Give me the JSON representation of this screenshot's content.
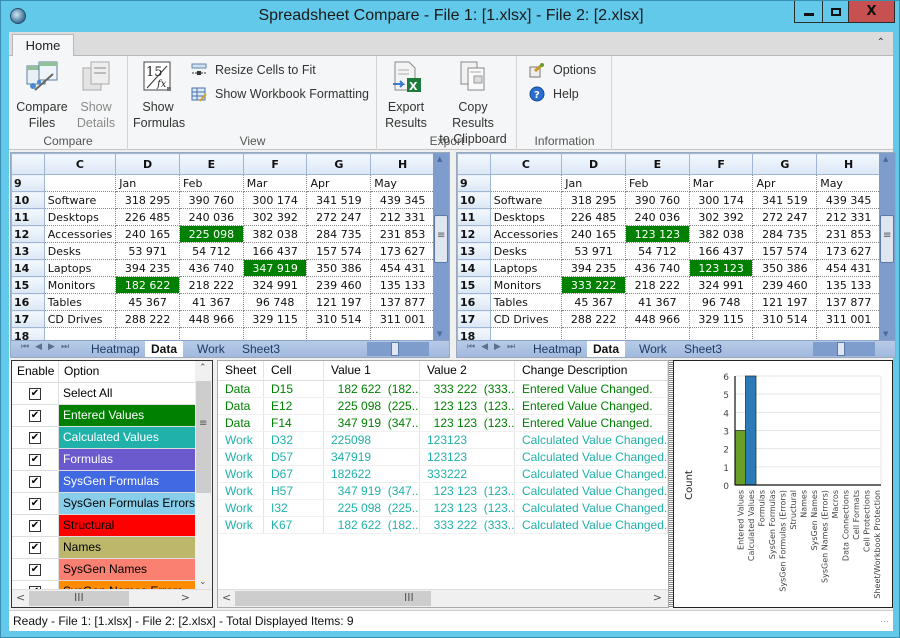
{
  "window": {
    "title": "Spreadsheet Compare - File 1: [1.xlsx] - File 2: [2.xlsx]",
    "close_label": "X"
  },
  "ribbon": {
    "tab": "Home",
    "groups": {
      "compare": {
        "label": "Compare",
        "compare_files": [
          "Compare",
          "Files"
        ],
        "show_details": [
          "Show",
          "Details"
        ]
      },
      "view": {
        "label": "View",
        "show_formulas": [
          "Show",
          "Formulas"
        ],
        "resize_cells": "Resize Cells to Fit",
        "show_workbook_formatting": "Show Workbook Formatting"
      },
      "export": {
        "label": "Export",
        "export_results": [
          "Export",
          "Results"
        ],
        "copy_results": [
          "Copy Results",
          "to Clipboard"
        ]
      },
      "information": {
        "label": "Information",
        "options": "Options",
        "help": "Help"
      }
    }
  },
  "sheets": {
    "columns": [
      "C",
      "D",
      "E",
      "F",
      "G",
      "H"
    ],
    "sheet_tabs": [
      "Heatmap",
      "Data",
      "Work",
      "Sheet3"
    ],
    "active_tab": "Data",
    "left": {
      "rows": [
        {
          "n": "9",
          "cells": [
            "",
            "Jan",
            "Feb",
            "Mar",
            "Apr",
            "May"
          ]
        },
        {
          "n": "10",
          "cells": [
            "Software",
            "318 295",
            "390 760",
            "300 174",
            "341 519",
            "439 345"
          ]
        },
        {
          "n": "11",
          "cells": [
            "Desktops",
            "226 485",
            "240 036",
            "302 392",
            "272 247",
            "212 331"
          ]
        },
        {
          "n": "12",
          "cells": [
            "Accessories",
            "240 165",
            "225 098",
            "382 038",
            "284 735",
            "231 853"
          ],
          "hl": [
            2
          ]
        },
        {
          "n": "13",
          "cells": [
            "Desks",
            "53 971",
            "54 712",
            "166 437",
            "157 574",
            "173 627"
          ]
        },
        {
          "n": "14",
          "cells": [
            "Laptops",
            "394 235",
            "436 740",
            "347 919",
            "350 386",
            "454 431"
          ],
          "hl": [
            3
          ]
        },
        {
          "n": "15",
          "cells": [
            "Monitors",
            "182 622",
            "218 222",
            "324 991",
            "239 460",
            "135 133"
          ],
          "hl": [
            1
          ]
        },
        {
          "n": "16",
          "cells": [
            "Tables",
            "45 367",
            "41 367",
            "96 748",
            "121 197",
            "137 877"
          ]
        },
        {
          "n": "17",
          "cells": [
            "CD Drives",
            "288 222",
            "448 966",
            "329 115",
            "310 514",
            "311 001"
          ]
        },
        {
          "n": "18",
          "cells": [
            "",
            "",
            "",
            "",
            "",
            ""
          ]
        }
      ]
    },
    "right": {
      "rows": [
        {
          "n": "9",
          "cells": [
            "",
            "Jan",
            "Feb",
            "Mar",
            "Apr",
            "May"
          ]
        },
        {
          "n": "10",
          "cells": [
            "Software",
            "318 295",
            "390 760",
            "300 174",
            "341 519",
            "439 345"
          ]
        },
        {
          "n": "11",
          "cells": [
            "Desktops",
            "226 485",
            "240 036",
            "302 392",
            "272 247",
            "212 331"
          ]
        },
        {
          "n": "12",
          "cells": [
            "Accessories",
            "240 165",
            "123 123",
            "382 038",
            "284 735",
            "231 853"
          ],
          "hl": [
            2
          ]
        },
        {
          "n": "13",
          "cells": [
            "Desks",
            "53 971",
            "54 712",
            "166 437",
            "157 574",
            "173 627"
          ]
        },
        {
          "n": "14",
          "cells": [
            "Laptops",
            "394 235",
            "436 740",
            "123 123",
            "350 386",
            "454 431"
          ],
          "hl": [
            3
          ]
        },
        {
          "n": "15",
          "cells": [
            "Monitors",
            "333 222",
            "218 222",
            "324 991",
            "239 460",
            "135 133"
          ],
          "hl": [
            1
          ]
        },
        {
          "n": "16",
          "cells": [
            "Tables",
            "45 367",
            "41 367",
            "96 748",
            "121 197",
            "137 877"
          ]
        },
        {
          "n": "17",
          "cells": [
            "CD Drives",
            "288 222",
            "448 966",
            "329 115",
            "310 514",
            "311 001"
          ]
        },
        {
          "n": "18",
          "cells": [
            "",
            "",
            "",
            "",
            "",
            ""
          ]
        }
      ]
    },
    "highlight_color": "#008000"
  },
  "options": {
    "headers": [
      "Enable",
      "Option"
    ],
    "items": [
      {
        "label": "Select All",
        "checked": true,
        "bg": "#ffffff",
        "fg": "#000000"
      },
      {
        "label": "Entered Values",
        "checked": true,
        "bg": "#008000",
        "fg": "#ffffff"
      },
      {
        "label": "Calculated Values",
        "checked": true,
        "bg": "#20b2aa",
        "fg": "#ffffff"
      },
      {
        "label": "Formulas",
        "checked": true,
        "bg": "#6a5acd",
        "fg": "#ffffff"
      },
      {
        "label": "SysGen Formulas",
        "checked": true,
        "bg": "#4169e1",
        "fg": "#ffffff"
      },
      {
        "label": "SysGen Formulas Errors",
        "checked": true,
        "bg": "#87ceeb",
        "fg": "#000000"
      },
      {
        "label": "Structural",
        "checked": true,
        "bg": "#ff0000",
        "fg": "#000000"
      },
      {
        "label": "Names",
        "checked": true,
        "bg": "#bdb76b",
        "fg": "#000000"
      },
      {
        "label": "SysGen Names",
        "checked": true,
        "bg": "#fa8072",
        "fg": "#000000"
      },
      {
        "label": "SysGen Names Errors",
        "checked": true,
        "bg": "#ff8c00",
        "fg": "#000000"
      }
    ]
  },
  "results": {
    "headers": [
      "Sheet",
      "Cell",
      "Value 1",
      "Value 2",
      "Change Description"
    ],
    "rows": [
      {
        "sheet": "Data",
        "cell": "D15",
        "v1": "  182 622  (182...",
        "v2": "  333 222  (333...",
        "desc": "Entered Value Changed.",
        "color": "#008000"
      },
      {
        "sheet": "Data",
        "cell": "E12",
        "v1": "  225 098  (225...",
        "v2": "  123 123  (123...",
        "desc": "Entered Value Changed.",
        "color": "#008000"
      },
      {
        "sheet": "Data",
        "cell": "F14",
        "v1": "  347 919  (347...",
        "v2": "  123 123  (123...",
        "desc": "Entered Value Changed.",
        "color": "#008000"
      },
      {
        "sheet": "Work",
        "cell": "D32",
        "v1": "225098",
        "v2": "123123",
        "desc": "Calculated Value Changed.",
        "color": "#20b2aa"
      },
      {
        "sheet": "Work",
        "cell": "D57",
        "v1": "347919",
        "v2": "123123",
        "desc": "Calculated Value Changed.",
        "color": "#20b2aa"
      },
      {
        "sheet": "Work",
        "cell": "D67",
        "v1": "182622",
        "v2": "333222",
        "desc": "Calculated Value Changed.",
        "color": "#20b2aa"
      },
      {
        "sheet": "Work",
        "cell": "H57",
        "v1": "  347 919  (347...",
        "v2": "  123 123  (123...",
        "desc": "Calculated Value Changed.",
        "color": "#20b2aa"
      },
      {
        "sheet": "Work",
        "cell": "I32",
        "v1": "  225 098  (225...",
        "v2": "  123 123  (123...",
        "desc": "Calculated Value Changed.",
        "color": "#20b2aa"
      },
      {
        "sheet": "Work",
        "cell": "K67",
        "v1": "  182 622  (182...",
        "v2": "  333 222  (333...",
        "desc": "Calculated Value Changed.",
        "color": "#20b2aa"
      }
    ]
  },
  "chart_data": {
    "type": "bar",
    "title": "",
    "xlabel": "",
    "ylabel": "Count",
    "ylim": [
      0,
      6
    ],
    "yticks": [
      0,
      1,
      2,
      3,
      4,
      5,
      6
    ],
    "grid": true,
    "categories": [
      "Entered Values",
      "Calculated Values",
      "Formulas",
      "SysGen Formulas",
      "SysGen Formulas (Errors)",
      "Structural",
      "Names",
      "SysGen Names",
      "SysGen Names (Errors)",
      "Macros",
      "Data Connections",
      "Cell Formats",
      "Cell Protections",
      "Sheet/Workbook Protection"
    ],
    "values": [
      3,
      6,
      0,
      0,
      0,
      0,
      0,
      0,
      0,
      0,
      0,
      0,
      0,
      0
    ],
    "colors": [
      "#6a9e2a",
      "#2c7ab8"
    ]
  },
  "status": {
    "text": "Ready - File 1: [1.xlsx] - File 2: [2.xlsx] - Total Displayed Items: 9"
  }
}
